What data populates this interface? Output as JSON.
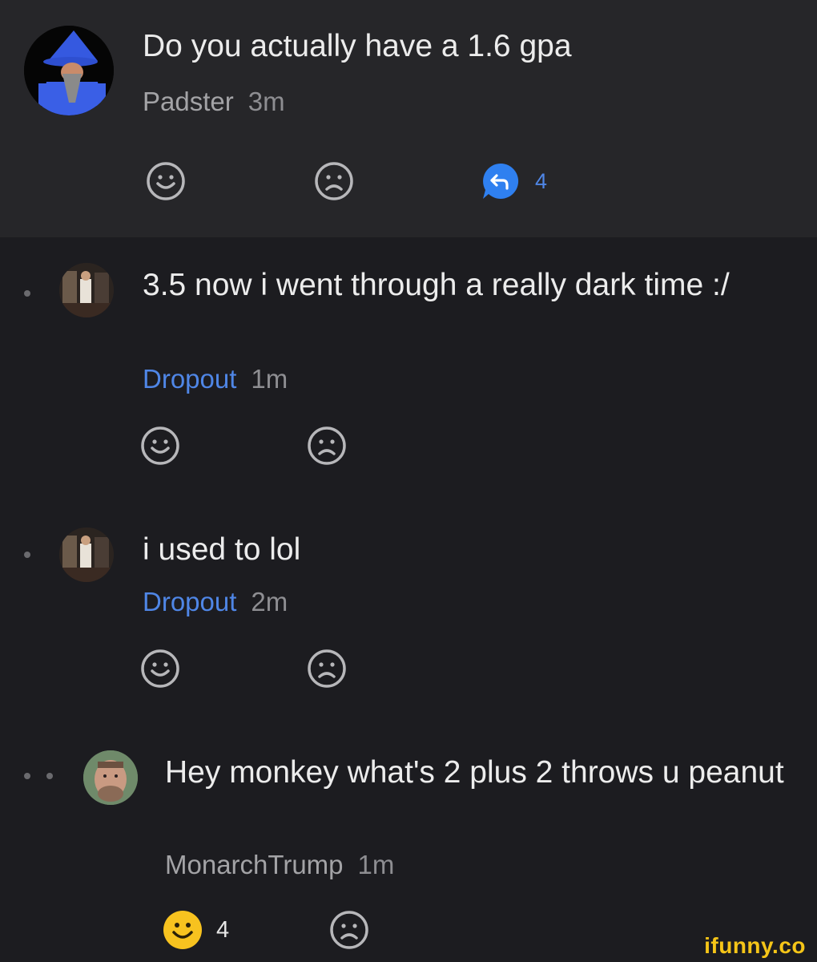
{
  "post": {
    "text": "Do you actually have a 1.6 gpa",
    "author": "Padster",
    "time": "3m",
    "reply_count": "4"
  },
  "replies": [
    {
      "text": "3.5 now i went through a really dark time :/",
      "author": "Dropout",
      "time": "1m"
    },
    {
      "text": "i used to lol",
      "author": "Dropout",
      "time": "2m"
    },
    {
      "text": "Hey monkey what's 2 plus 2 throws u peanut",
      "author": "MonarchTrump",
      "time": "1m",
      "like_count": "4"
    }
  ],
  "icons": {
    "smile": "smile-icon",
    "frown": "frown-icon",
    "reply": "reply-icon",
    "liked": "smile-filled-icon"
  },
  "colors": {
    "link": "#4f86e6",
    "liked": "#f7c21f",
    "watermark": "#f5c518"
  },
  "watermark": "ifunny.co"
}
